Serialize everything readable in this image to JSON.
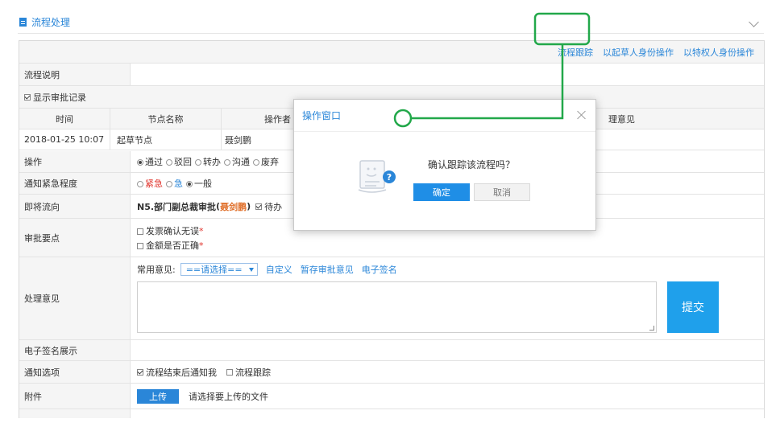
{
  "header": {
    "title": "流程处理",
    "doc_icon": "document-icon",
    "collapse_icon": "chevron-down-icon"
  },
  "top_links": [
    "流程跟踪",
    "以起草人身份操作",
    "以特权人身份操作"
  ],
  "rows": {
    "flow_desc_label": "流程说明",
    "show_history_label": "显示审批记录",
    "operation_label": "操作",
    "urgency_label": "通知紧急程度",
    "next_flow_label": "即将流向",
    "key_points_label": "审批要点",
    "opinion_label": "处理意见",
    "signature_label": "电子签名展示",
    "notify_label": "通知选项",
    "attachment_label": "附件"
  },
  "history": {
    "headers": [
      "时间",
      "节点名称",
      "操作者",
      "理意见"
    ],
    "rows": [
      {
        "time": "2018-01-25 10:07",
        "node": "起草节点",
        "operator": "聂剑鹏"
      }
    ]
  },
  "operation_options": [
    "通过",
    "驳回",
    "转办",
    "沟通",
    "废弃"
  ],
  "urgency": {
    "urgent": "紧急",
    "hurry": "急",
    "normal": "一般"
  },
  "next_flow": {
    "node": "N5.部门副总裁审批",
    "person": "聂剑鹏",
    "pending": "待办"
  },
  "key_points": [
    {
      "text": "发票确认无误",
      "required": "*"
    },
    {
      "text": "金额是否正确",
      "required": "*"
    }
  ],
  "opinion": {
    "common_label": "常用意见:",
    "select_value": "==请选择==",
    "links": [
      "自定义",
      "暂存审批意见",
      "电子签名"
    ],
    "submit": "提交"
  },
  "notify_options": [
    "流程结束后通知我",
    "流程跟踪"
  ],
  "attachment": {
    "upload": "上传",
    "hint": "请选择要上传的文件"
  },
  "modal": {
    "title": "操作窗口",
    "message": "确认跟踪该流程吗？",
    "ok": "确定",
    "cancel": "取消",
    "close_icon": "close-icon",
    "illustration_icon": "question-document-icon"
  },
  "colors": {
    "accent": "#2a86d8",
    "submit": "#1fa0eb",
    "annotation": "#22a84a",
    "required": "#e0332b"
  }
}
